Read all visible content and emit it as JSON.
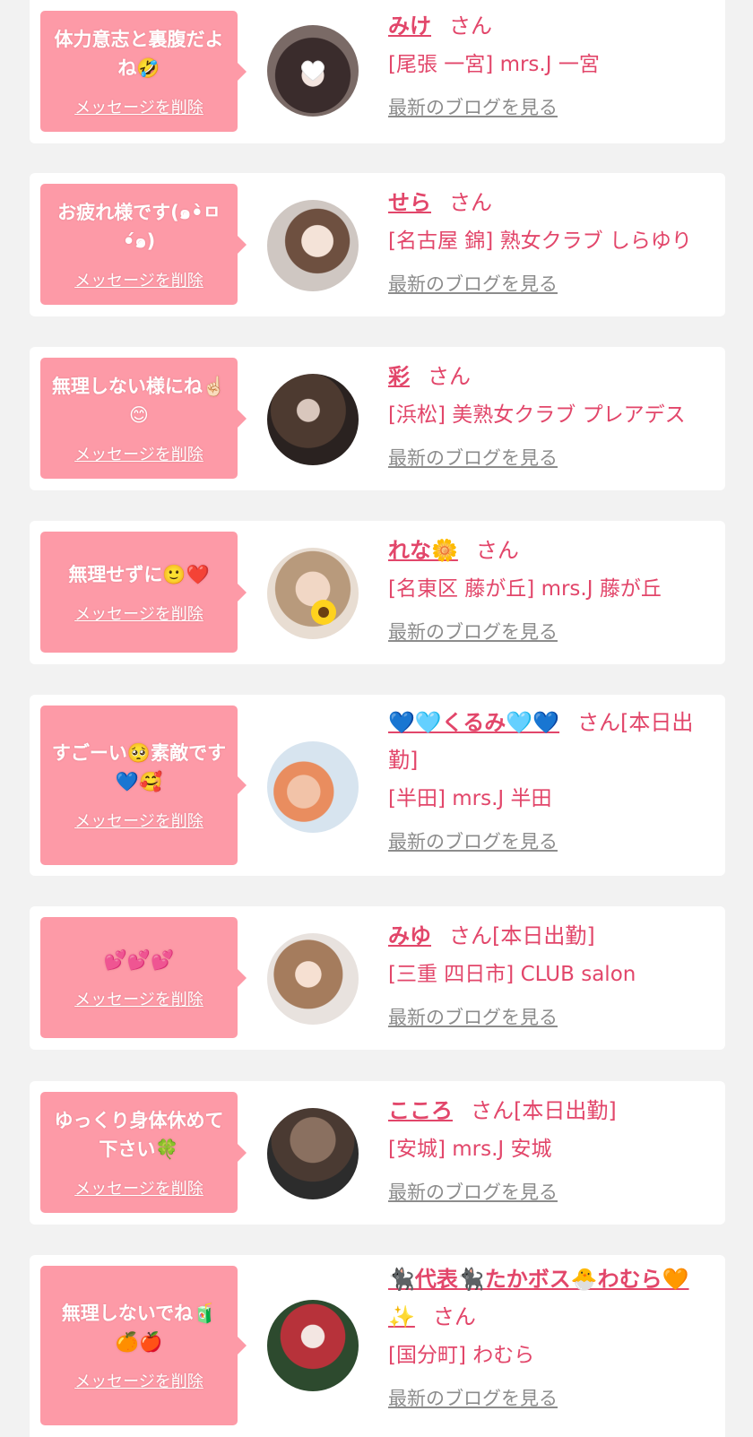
{
  "colors": {
    "accent": "#e2466a",
    "bubble": "#fd9aa7",
    "link_gray": "#8c8c8c",
    "background": "#f2f2f2"
  },
  "delete_label": "メッセージを削除",
  "blog_label": "最新のブログを見る",
  "cards": [
    {
      "message": "体力意志と裏腹だよね🤣",
      "name": "みけ",
      "suffix": "さん",
      "shop": "[尾張 一宮] mrs.J 一宮"
    },
    {
      "message": "お疲れ様です(๑•̀ㅁ•́๑)",
      "name": "せら",
      "suffix": "さん",
      "shop": "[名古屋 錦] 熟女クラブ しらゆり"
    },
    {
      "message": "無理しない様にね☝🏻😊",
      "name": "彩",
      "suffix": "さん",
      "shop": "[浜松] 美熟女クラブ プレアデス"
    },
    {
      "message": "無理せずに🙂❤️",
      "name": "れな🌼",
      "suffix": "さん",
      "shop": "[名東区 藤が丘] mrs.J 藤が丘"
    },
    {
      "message": "すごーい🥺素敵です💙🥰",
      "name": "💙🩵くるみ🩵💙",
      "suffix": "さん[本日出勤]",
      "shop": "[半田] mrs.J 半田"
    },
    {
      "message": "💕💕💕",
      "name": "みゆ",
      "suffix": "さん[本日出勤]",
      "shop": "[三重 四日市] CLUB salon"
    },
    {
      "message": "ゆっくり身体休めて下さい🍀",
      "name": "こころ",
      "suffix": "さん[本日出勤]",
      "shop": "[安城] mrs.J 安城"
    },
    {
      "message": "無理しないでね🧃🍊🍎",
      "name": "🐈‍⬛代表🐈‍⬛たかボス🐣わむら🧡✨",
      "suffix": "さん",
      "shop": "[国分町] わむら"
    }
  ]
}
